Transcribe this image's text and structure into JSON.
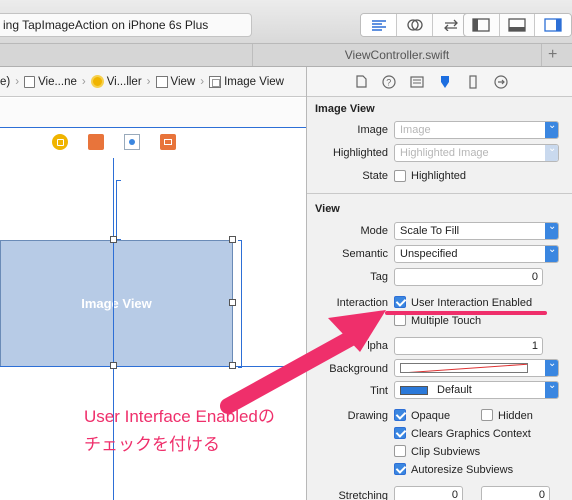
{
  "toolbar": {
    "status_text": "ing TapImageAction on iPhone 6s Plus"
  },
  "tab": {
    "file_name": "ViewController.swift",
    "plus": "+"
  },
  "jumpbar": {
    "items": [
      "e)",
      "Vie...ne",
      "Vi...ller",
      "View",
      "Image View"
    ]
  },
  "canvas": {
    "image_view_label": "Image View"
  },
  "inspector": {
    "image_view_section": {
      "title": "Image View",
      "image_label": "Image",
      "image_placeholder": "Image",
      "highlighted_label": "Highlighted",
      "highlighted_placeholder": "Highlighted Image",
      "state_label": "State",
      "state_checkbox": "Highlighted"
    },
    "view_section": {
      "title": "View",
      "mode_label": "Mode",
      "mode_value": "Scale To Fill",
      "semantic_label": "Semantic",
      "semantic_value": "Unspecified",
      "tag_label": "Tag",
      "tag_value": "0",
      "interaction_label": "Interaction",
      "user_interaction": "User Interaction Enabled",
      "multiple_touch": "Multiple Touch",
      "alpha_label": "lpha",
      "alpha_value": "1",
      "background_label": "Background",
      "tint_label": "Tint",
      "tint_value": "Default",
      "drawing_label": "Drawing",
      "opaque": "Opaque",
      "hidden": "Hidden",
      "clears_graphics": "Clears Graphics Context",
      "clip_subviews": "Clip Subviews",
      "autoresize": "Autoresize Subviews",
      "stretching_label": "Stretching",
      "stretch_x": "0",
      "stretch_y": "0"
    }
  },
  "annotation": {
    "line1": "User Interface Enabledの",
    "line2": "チェックを付ける",
    "color": "#ef2f6b"
  }
}
